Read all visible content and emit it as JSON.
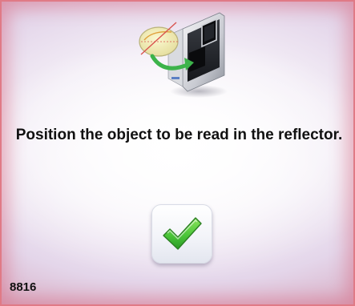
{
  "screen": {
    "instruction": "Position the object to be read in the reflector.",
    "code": "8816"
  },
  "icons": {
    "illustration": "tracer-device-with-lens-icon",
    "confirm": "checkmark-icon"
  },
  "colors": {
    "border_accent": "#e07a86",
    "check_green": "#4cc63a",
    "text": "#111111"
  }
}
